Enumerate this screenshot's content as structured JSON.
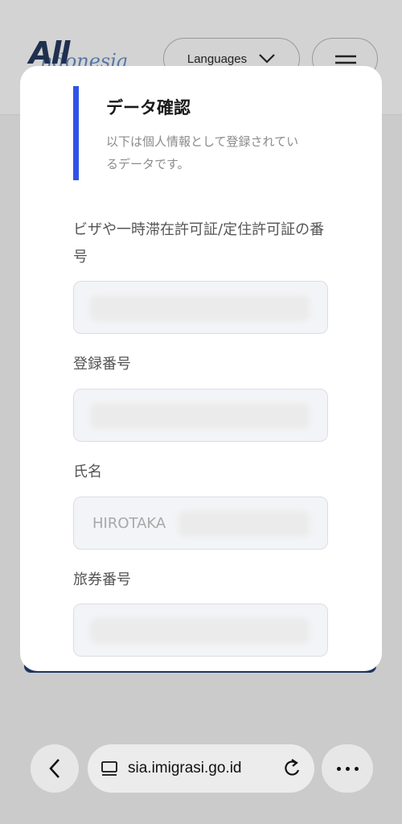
{
  "background_site": {
    "logo_main": "All",
    "logo_sub": "ndonesia",
    "language_button_label": "Languages"
  },
  "modal": {
    "title": "データ確認",
    "description": "以下は個人情報として登録されているデータです。",
    "fields": [
      {
        "label": "ビザや一時滞在許可証/定住許可証の番号",
        "value": "",
        "redacted": true
      },
      {
        "label": "登録番号",
        "value": "",
        "redacted": true
      },
      {
        "label": "氏名",
        "value": "HIROTAKA",
        "redacted": true
      },
      {
        "label": "旅券番号",
        "value": "",
        "redacted": true
      }
    ]
  },
  "browser": {
    "url": "sia.imigrasi.go.id"
  },
  "colors": {
    "accent": "#2f54e6",
    "brand_dark": "#1c355e"
  }
}
